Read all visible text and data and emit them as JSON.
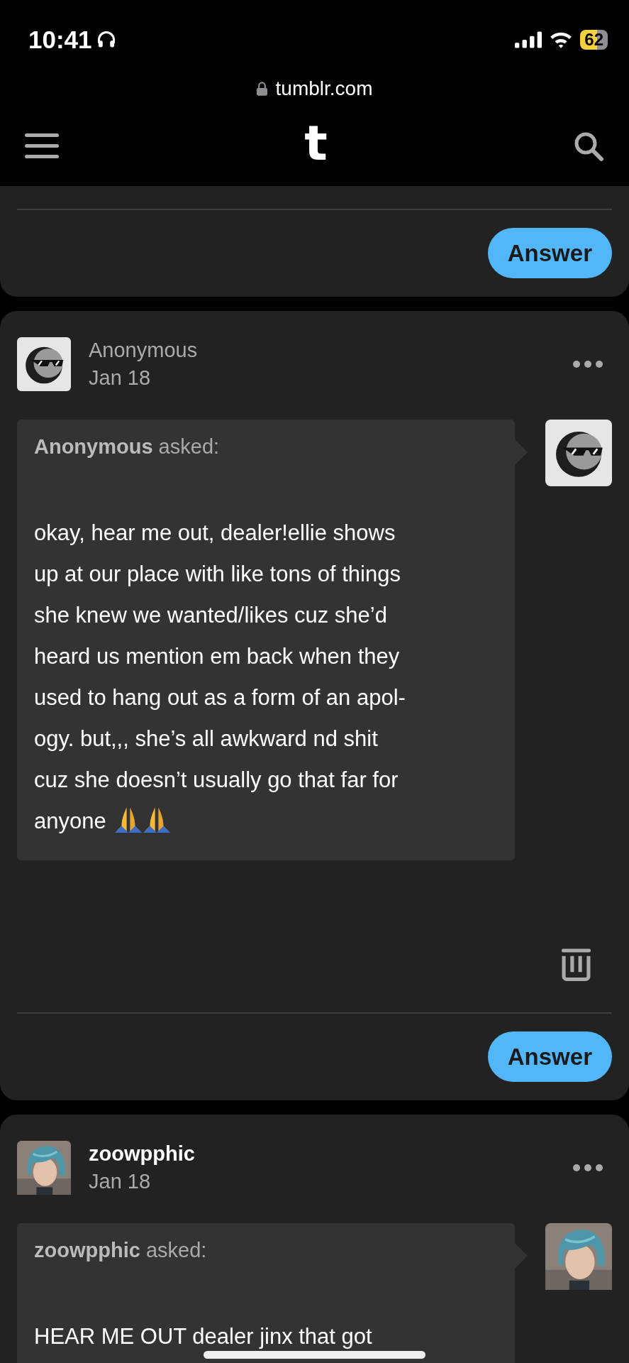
{
  "status_bar": {
    "time": "10:41",
    "battery": "62"
  },
  "address_bar": {
    "url": "tumblr.com"
  },
  "nav": {
    "logo": "t"
  },
  "posts": [
    {
      "kind": "partial",
      "answer_button": "Answer"
    },
    {
      "kind": "ask",
      "anonymous": true,
      "author": "Anonymous",
      "date": "Jan 18",
      "asker_line": "**Anonymous** asked:",
      "question_lines": [
        "okay, hear me out, dealer!ellie shows",
        "up at our place with like tons of things",
        "she knew we wanted/likes cuz she’d",
        "heard us mention em back when they",
        "used to hang out as a form of an apol-",
        "ogy. but,,, she’s all awkward nd shit",
        "cuz she doesn’t usually go that far for",
        "anyone"
      ],
      "end_icons": [
        {
          "kind": "praying-hands"
        },
        {
          "kind": "praying-hands"
        }
      ],
      "deletable": true,
      "answer_button": "Answer"
    },
    {
      "kind": "ask",
      "anonymous": false,
      "author": "zoowpphic",
      "date": "Jan 18",
      "asker_line": "**zoowpphic** asked:",
      "question_lines": [
        "HEAR ME OUT dealer jinx that got"
      ],
      "deletable": false
    }
  ]
}
